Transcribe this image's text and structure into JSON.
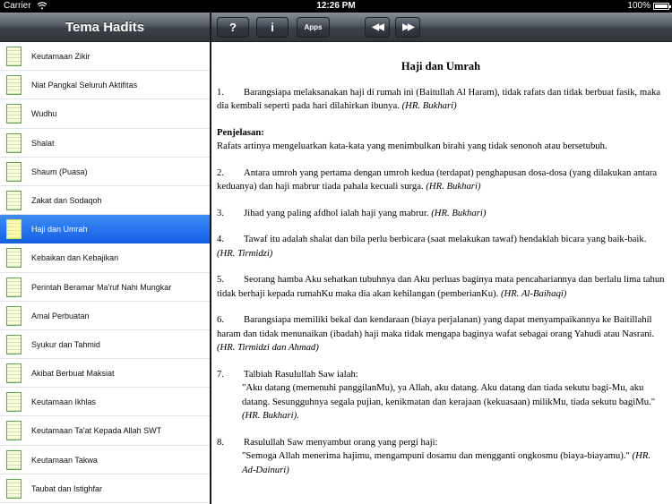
{
  "status": {
    "carrier": "Carrier",
    "time": "12:26 PM",
    "battery": "100%"
  },
  "sidebar": {
    "title": "Tema Hadits",
    "items": [
      {
        "label": "Keutamaan Zikir"
      },
      {
        "label": "Niat Pangkal Seluruh Aktifitas"
      },
      {
        "label": "Wudhu"
      },
      {
        "label": "Shalat"
      },
      {
        "label": "Shaum (Puasa)"
      },
      {
        "label": "Zakat dan Sodaqoh"
      },
      {
        "label": "Haji dan Umrah",
        "selected": true
      },
      {
        "label": "Kebaikan dan Kebajikan"
      },
      {
        "label": "Perintah Beramar Ma'ruf Nahi Mungkar"
      },
      {
        "label": "Amal Perbuatan"
      },
      {
        "label": "Syukur dan Tahmid"
      },
      {
        "label": "Akibat Berbuat Maksiat"
      },
      {
        "label": "Keutamaan Ikhlas"
      },
      {
        "label": "Keutamaan Ta'at Kepada Allah SWT"
      },
      {
        "label": "Keutamaan Takwa"
      },
      {
        "label": "Taubat dan Istighfar"
      }
    ]
  },
  "toolbar": {
    "help_label": "?",
    "info_label": "i",
    "apps_label": "Apps",
    "prev_label": "◀◀",
    "next_label": "▶▶"
  },
  "content": {
    "title": "Haji dan Umrah",
    "items": [
      {
        "num": "1.",
        "text": "Barangsiapa melaksanakan haji di rumah ini (Baitullah Al Haram), tidak rafats dan tidak berbuat fasik, maka dia kembali seperti pada hari dilahirkan ibunya.",
        "ref": "(HR. Bukhari)"
      },
      {
        "num": "2.",
        "text": "Antara umroh yang pertama dengan umroh kedua (terdapat) penghapusan dosa-dosa (yang dilakukan antara keduanya) dan haji mabrur tiada pahala kecuali surga.",
        "ref": "(HR. Bukhari)"
      },
      {
        "num": "3.",
        "text": "Jihad yang paling afdhol ialah haji yang mabrur.",
        "ref": "(HR. Bukhari)"
      },
      {
        "num": "4.",
        "text": "Tawaf itu adalah shalat dan bila perlu berbicara (saat melakukan tawaf) hendaklah bicara yang baik-baik.",
        "ref": "(HR. Tirmidzi)"
      },
      {
        "num": "5.",
        "text": "Seorang hamba Aku sehatkan tubuhnya dan Aku perluas baginya mata pencahariannya dan berlalu lima tahun tidak berhaji kepada rumahKu maka dia akan kehilangan (pemberianKu).",
        "ref": "(HR. Al-Baihaqi)"
      },
      {
        "num": "6.",
        "text": "Barangsiapa memiliki bekal dan kendaraan (biaya perjalanan) yang dapat menyampaikannya ke Baitillahil haram dan tidak menunaikan (ibadah) haji maka tidak mengapa baginya wafat sebagai orang Yahudi atau Nasrani.",
        "ref": "(HR. Tirmidzi dan Ahmad)"
      },
      {
        "num": "7.",
        "text": "Talbiah Rasulullah Saw ialah:",
        "quote": "\"Aku datang (memenuhi panggilanMu), ya Allah, aku datang. Aku datang dan tiada sekutu bagi-Mu, aku datang. Sesungguhnya segala pujian, kenikmatan dan kerajaan (kekuasaan) milikMu, tiada sekutu bagiMu.\"",
        "ref": "(HR. Bukhari)."
      },
      {
        "num": "8.",
        "text": "Rasulullah Saw menyambut orang yang pergi haji:",
        "quote": "\"Semoga Allah menerima hajimu, mengampuni dosamu dan mengganti ongkosmu (biaya-biayamu).\"",
        "ref": "(HR. Ad-Dainuri)"
      }
    ],
    "penjelasan": {
      "label": "Penjelasan:",
      "text": "Rafats artinya mengeluarkan kata-kata yang menimbulkan birahi yang tidak senonoh atau bersetubuh."
    }
  }
}
